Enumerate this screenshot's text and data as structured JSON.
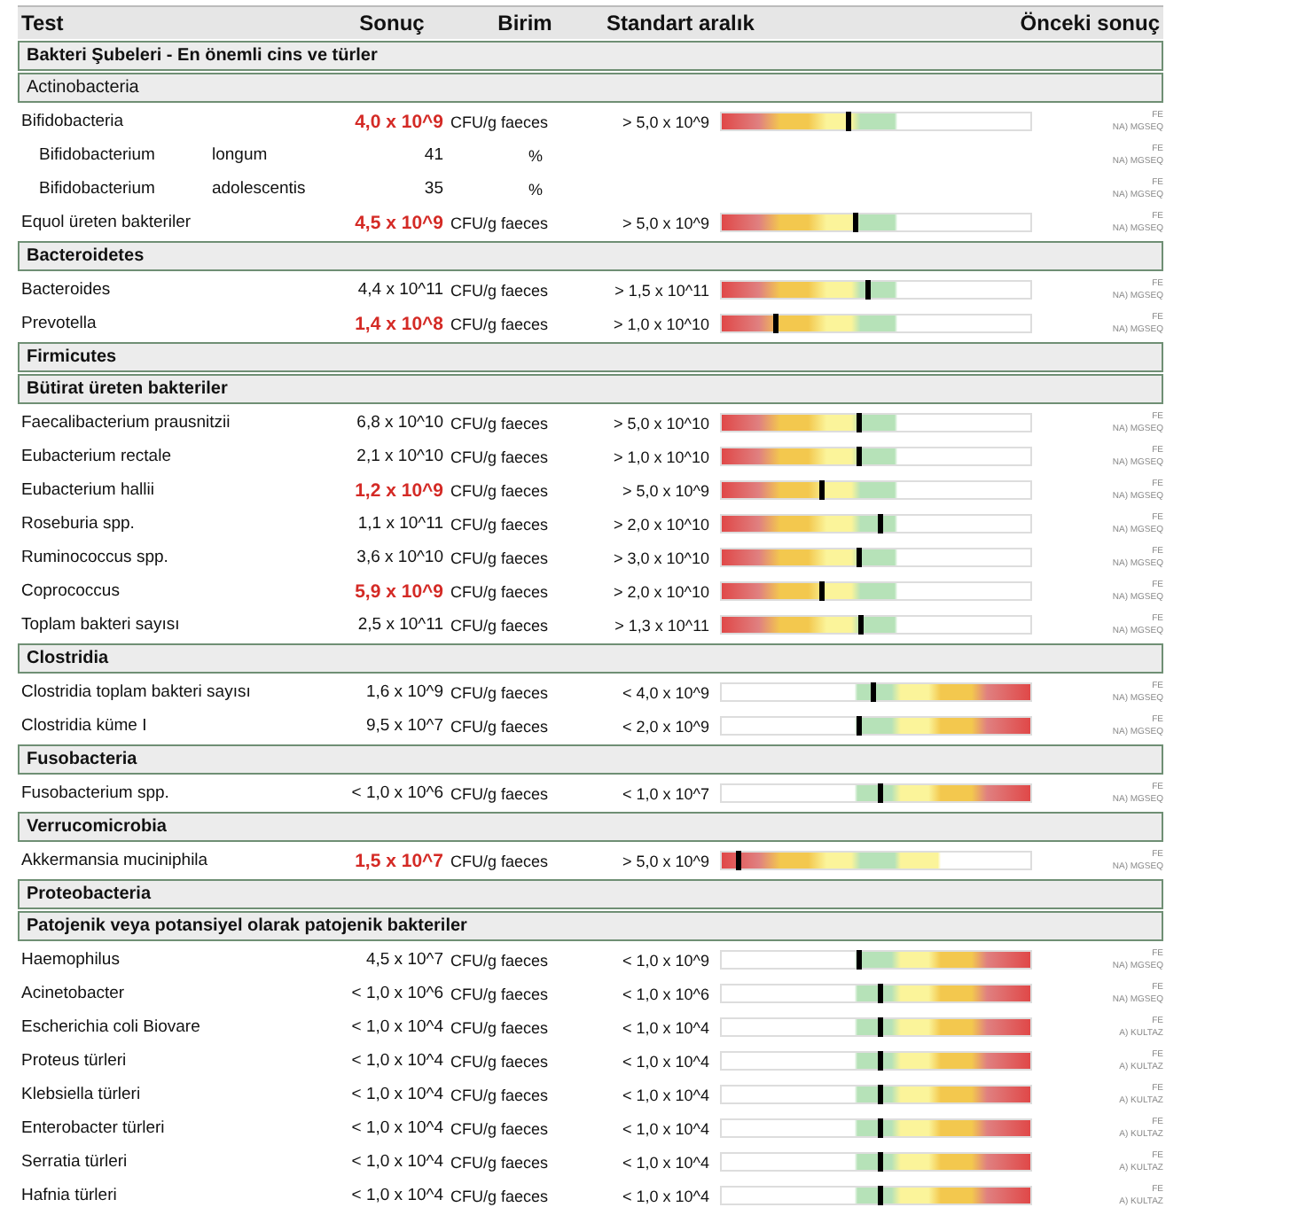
{
  "columns": [
    "Test",
    "Sonuç",
    "Birim",
    "Standart aralık",
    "Önceki sonuç"
  ],
  "sections": [
    {
      "title": "Bakteri Şubeleri - En önemli cins ve türler",
      "emphasis": true
    },
    {
      "title": "Actinobacteria",
      "emphasis": false,
      "rows": [
        {
          "kind": "above",
          "name": "Bifidobacteria",
          "value": "4,0 x 10^9",
          "abnormal": true,
          "unit": "CFU/g faeces",
          "range": "> 5,0 x 10^9",
          "level": 0.41,
          "note": [
            "FE",
            "NA) MGSEQ"
          ]
        },
        {
          "kind": "sub",
          "name": "Bifidobacterium",
          "species": "longum",
          "value": "41",
          "abnormal": false,
          "unit": "%",
          "note": [
            "FE",
            "NA) MGSEQ"
          ]
        },
        {
          "kind": "sub",
          "name": "Bifidobacterium",
          "species": "adolescentis",
          "value": "35",
          "abnormal": false,
          "unit": "%",
          "note": [
            "FE",
            "NA) MGSEQ"
          ]
        },
        {
          "kind": "above",
          "name": "Equol üreten bakteriler",
          "value": "4,5 x 10^9",
          "abnormal": true,
          "unit": "CFU/g faeces",
          "range": "> 5,0 x 10^9",
          "level": 0.43,
          "note": [
            "FE",
            "NA) MGSEQ"
          ]
        }
      ]
    },
    {
      "title": "Bacteroidetes",
      "emphasis": true,
      "rows": [
        {
          "kind": "above",
          "name": "Bacteroides",
          "value": "4,4 x 10^11",
          "abnormal": false,
          "unit": "CFU/g faeces",
          "range": "> 1,5 x 10^11",
          "level": 0.47,
          "note": [
            "FE",
            "NA) MGSEQ"
          ]
        },
        {
          "kind": "above",
          "name": "Prevotella",
          "value": "1,4 x 10^8",
          "abnormal": true,
          "unit": "CFU/g faeces",
          "range": "> 1,0 x 10^10",
          "level": 0.17,
          "note": [
            "FE",
            "NA) MGSEQ"
          ]
        }
      ]
    },
    {
      "title": "Firmicutes",
      "emphasis": true
    },
    {
      "title": "Bütirat üreten bakteriler",
      "emphasis": true,
      "rows": [
        {
          "kind": "above",
          "name": "Faecalibacterium prausnitzii",
          "value": "6,8 x 10^10",
          "abnormal": false,
          "unit": "CFU/g faeces",
          "range": "> 5,0 x 10^10",
          "level": 0.44,
          "note": [
            "FE",
            "NA) MGSEQ"
          ]
        },
        {
          "kind": "above",
          "name": "Eubacterium rectale",
          "value": "2,1 x 10^10",
          "abnormal": false,
          "unit": "CFU/g faeces",
          "range": "> 1,0 x 10^10",
          "level": 0.44,
          "note": [
            "FE",
            "NA) MGSEQ"
          ]
        },
        {
          "kind": "above",
          "name": "Eubacterium hallii",
          "value": "1,2 x 10^9",
          "abnormal": true,
          "unit": "CFU/g faeces",
          "range": "> 5,0 x 10^9",
          "level": 0.32,
          "note": [
            "FE",
            "NA) MGSEQ"
          ]
        },
        {
          "kind": "above",
          "name": "Roseburia spp.",
          "value": "1,1 x 10^11",
          "abnormal": false,
          "unit": "CFU/g faeces",
          "range": "> 2,0 x 10^10",
          "level": 0.51,
          "note": [
            "FE",
            "NA) MGSEQ"
          ]
        },
        {
          "kind": "above",
          "name": "Ruminococcus spp.",
          "value": "3,6 x 10^10",
          "abnormal": false,
          "unit": "CFU/g faeces",
          "range": "> 3,0 x 10^10",
          "level": 0.44,
          "note": [
            "FE",
            "NA) MGSEQ"
          ]
        },
        {
          "kind": "above",
          "name": "Coprococcus",
          "value": "5,9 x 10^9",
          "abnormal": true,
          "unit": "CFU/g faeces",
          "range": "> 2,0 x 10^10",
          "level": 0.32,
          "note": [
            "FE",
            "NA) MGSEQ"
          ]
        },
        {
          "kind": "above",
          "name": "Toplam bakteri sayısı",
          "value": "2,5 x 10^11",
          "abnormal": false,
          "unit": "CFU/g faeces",
          "range": "> 1,3 x 10^11",
          "level": 0.45,
          "note": [
            "FE",
            "NA) MGSEQ"
          ]
        }
      ]
    },
    {
      "title": "Clostridia",
      "emphasis": true,
      "rows": [
        {
          "kind": "below",
          "name": "Clostridia toplam bakteri sayısı",
          "value": "1,6 x 10^9",
          "abnormal": false,
          "unit": "CFU/g faeces",
          "range": "< 4,0 x 10^9",
          "level": 0.49,
          "note": [
            "FE",
            "NA) MGSEQ"
          ]
        },
        {
          "kind": "below",
          "name": "Clostridia küme I",
          "value": "9,5 x 10^7",
          "abnormal": false,
          "unit": "CFU/g faeces",
          "range": "< 2,0 x 10^9",
          "level": 0.44,
          "note": [
            "FE",
            "NA) MGSEQ"
          ]
        }
      ]
    },
    {
      "title": "Fusobacteria",
      "emphasis": true,
      "rows": [
        {
          "kind": "below",
          "name": "Fusobacterium spp.",
          "value": "< 1,0 x 10^6",
          "abnormal": false,
          "unit": "CFU/g faeces",
          "range": "< 1,0 x 10^7",
          "level": 0.51,
          "note": [
            "FE",
            "NA) MGSEQ"
          ]
        }
      ]
    },
    {
      "title": "Verrucomicrobia",
      "emphasis": true,
      "rows": [
        {
          "kind": "window",
          "name": "Akkermansia muciniphila",
          "value": "1,5 x 10^7",
          "abnormal": true,
          "unit": "CFU/g faeces",
          "range": "> 5,0 x 10^9",
          "level": 0.05,
          "note": [
            "FE",
            "NA) MGSEQ"
          ]
        }
      ]
    },
    {
      "title": "Proteobacteria",
      "emphasis": true
    },
    {
      "title": "Patojenik veya potansiyel olarak patojenik bakteriler",
      "emphasis": true,
      "rows": [
        {
          "kind": "below",
          "name": "Haemophilus",
          "value": "4,5 x 10^7",
          "abnormal": false,
          "unit": "CFU/g faeces",
          "range": "< 1,0 x 10^9",
          "level": 0.44,
          "note": [
            "FE",
            "NA) MGSEQ"
          ]
        },
        {
          "kind": "below",
          "name": "Acinetobacter",
          "value": "< 1,0 x 10^6",
          "abnormal": false,
          "unit": "CFU/g faeces",
          "range": "< 1,0 x 10^6",
          "level": 0.51,
          "note": [
            "FE",
            "NA) MGSEQ"
          ]
        },
        {
          "kind": "below",
          "name": "Escherichia coli Biovare",
          "value": "< 1,0 x 10^4",
          "abnormal": false,
          "unit": "CFU/g faeces",
          "range": "< 1,0 x 10^4",
          "level": 0.51,
          "note": [
            "FE",
            "A) KULTAZ"
          ]
        },
        {
          "kind": "below",
          "name": "Proteus türleri",
          "value": "< 1,0 x 10^4",
          "abnormal": false,
          "unit": "CFU/g faeces",
          "range": "< 1,0 x 10^4",
          "level": 0.51,
          "note": [
            "FE",
            "A) KULTAZ"
          ]
        },
        {
          "kind": "below",
          "name": "Klebsiella türleri",
          "value": "< 1,0 x 10^4",
          "abnormal": false,
          "unit": "CFU/g faeces",
          "range": "< 1,0 x 10^4",
          "level": 0.51,
          "note": [
            "FE",
            "A) KULTAZ"
          ]
        },
        {
          "kind": "below",
          "name": "Enterobacter türleri",
          "value": "< 1,0 x 10^4",
          "abnormal": false,
          "unit": "CFU/g faeces",
          "range": "< 1,0 x 10^4",
          "level": 0.51,
          "note": [
            "FE",
            "A) KULTAZ"
          ]
        },
        {
          "kind": "below",
          "name": "Serratia türleri",
          "value": "< 1,0 x 10^4",
          "abnormal": false,
          "unit": "CFU/g faeces",
          "range": "< 1,0 x 10^4",
          "level": 0.51,
          "note": [
            "FE",
            "A) KULTAZ"
          ]
        },
        {
          "kind": "below",
          "name": "Hafnia türleri",
          "value": "< 1,0 x 10^4",
          "abnormal": false,
          "unit": "CFU/g faeces",
          "range": "< 1,0 x 10^4",
          "level": 0.51,
          "note": [
            "FE",
            "A) KULTAZ"
          ]
        }
      ]
    }
  ]
}
